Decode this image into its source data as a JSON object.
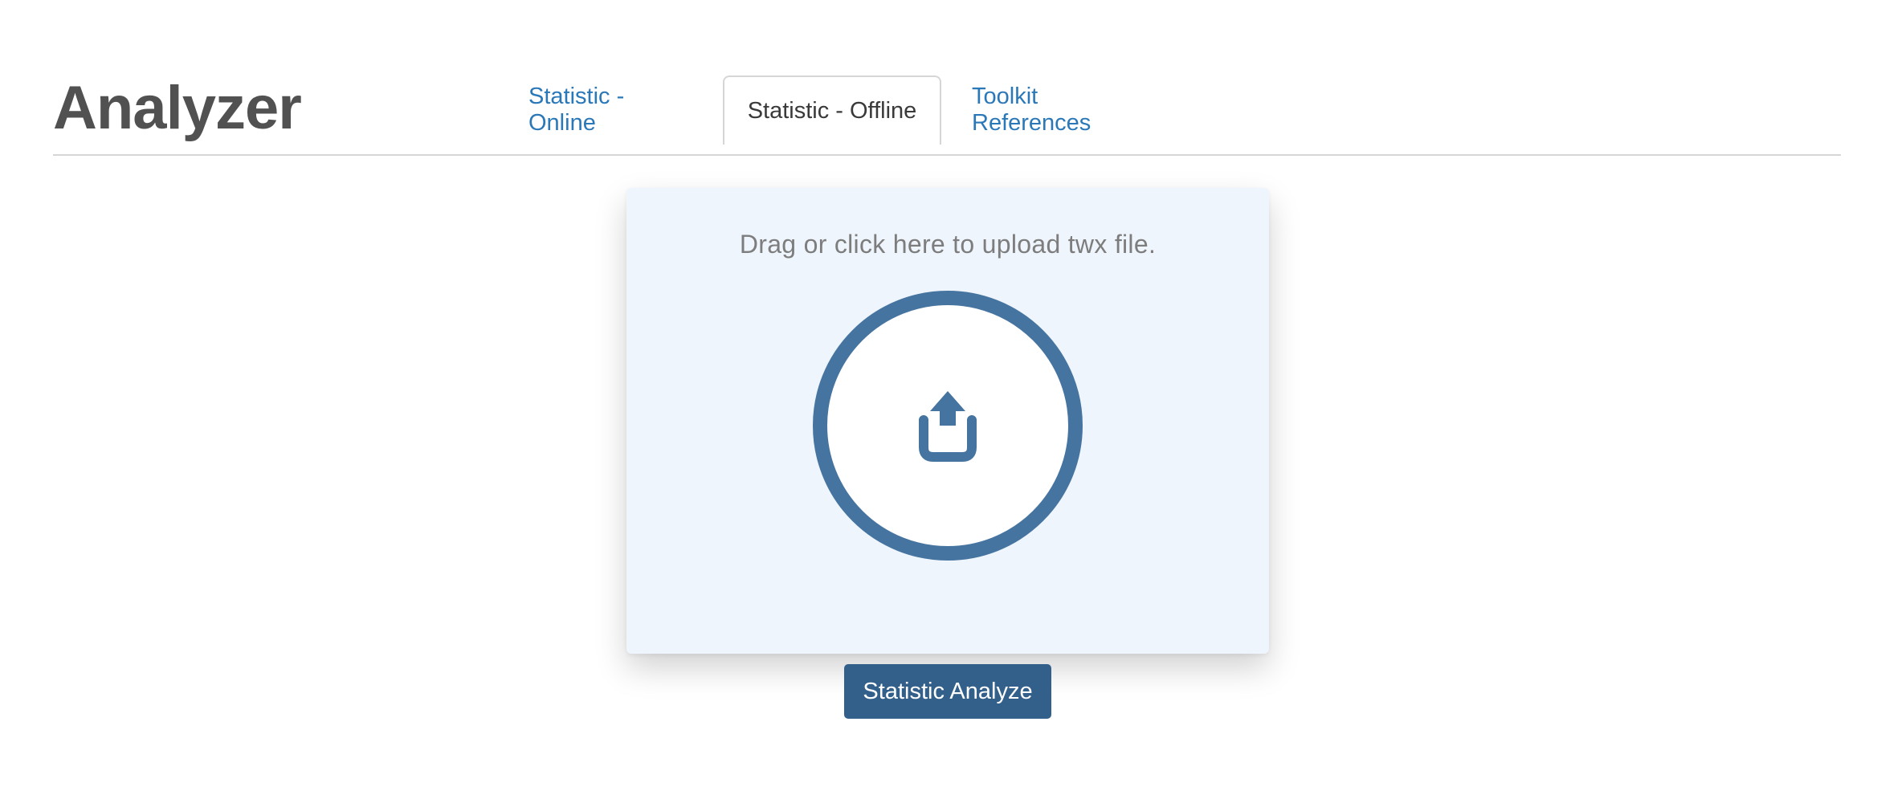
{
  "header": {
    "title": "Analyzer"
  },
  "tabs": [
    {
      "label": "Statistic - Online",
      "active": false
    },
    {
      "label": "Statistic - Offline",
      "active": true
    },
    {
      "label": "Toolkit References",
      "active": false
    }
  ],
  "upload": {
    "hint": "Drag or click here to upload twx file.",
    "icon": "upload-icon"
  },
  "actions": {
    "analyze_label": "Statistic Analyze"
  },
  "colors": {
    "link": "#2a78b8",
    "accent": "#4674a0",
    "button": "#33608b",
    "dropzone_bg": "#eef5fc"
  }
}
